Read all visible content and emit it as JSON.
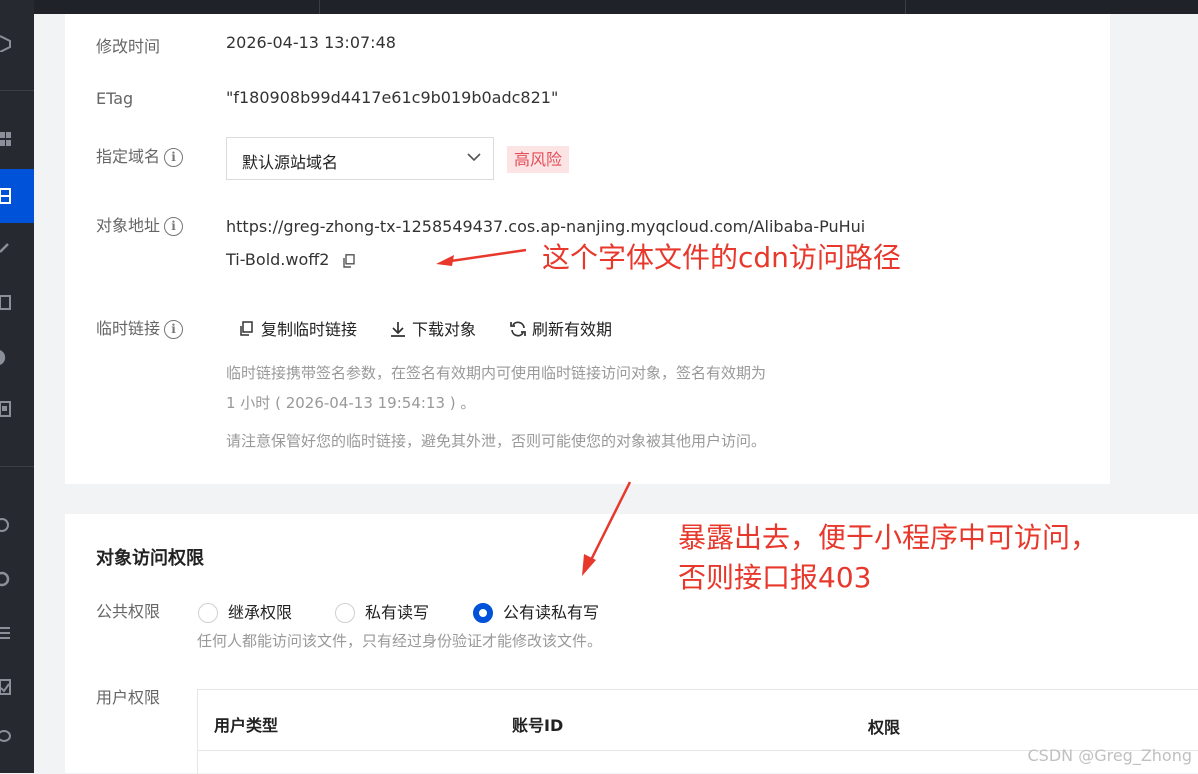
{
  "details": {
    "modified_label": "修改时间",
    "modified_value": "2026-04-13 13:07:48",
    "etag_label": "ETag",
    "etag_value": "\"f180908b99d4417e61c9b019b0adc821\"",
    "domain_label": "指定域名",
    "domain_select": "默认源站域名",
    "risk_badge": "高风险",
    "address_label": "对象地址",
    "address_value": "https://greg-zhong-tx-1258549437.cos.ap-nanjing.myqcloud.com/Alibaba-PuHuiTi-Bold.woff2",
    "templink_label": "临时链接",
    "copy_temp_link": "复制临时链接",
    "download_object": "下载对象",
    "refresh_validity": "刷新有效期",
    "temp_hint_1": "临时链接携带签名参数，在签名有效期内可使用临时链接访问对象，签名有效期为",
    "temp_hint_2": "1 小时 ( 2026-04-13 19:54:13 ) 。",
    "temp_hint_3": "请注意保管好您的临时链接，避免其外泄，否则可能使您的对象被其他用户访问。"
  },
  "annotations": {
    "cdn_note": "这个字体文件的cdn访问路径",
    "public_note_1": "暴露出去，便于小程序中可访问，",
    "public_note_2": "否则接口报403",
    "color": "#e8382c"
  },
  "permissions": {
    "title": "对象访问权限",
    "public_label": "公共权限",
    "options": [
      "继承权限",
      "私有读写",
      "公有读私有写"
    ],
    "selected": "公有读私有写",
    "public_hint": "任何人都能访问该文件，只有经过身份验证才能修改该文件。",
    "user_label": "用户权限",
    "columns": [
      "用户类型",
      "账号ID",
      "权限"
    ]
  },
  "watermark": "CSDN @Greg_Zhong",
  "colors": {
    "accent": "#0052d9",
    "danger": "#e34d59",
    "rail": "#26292f"
  }
}
